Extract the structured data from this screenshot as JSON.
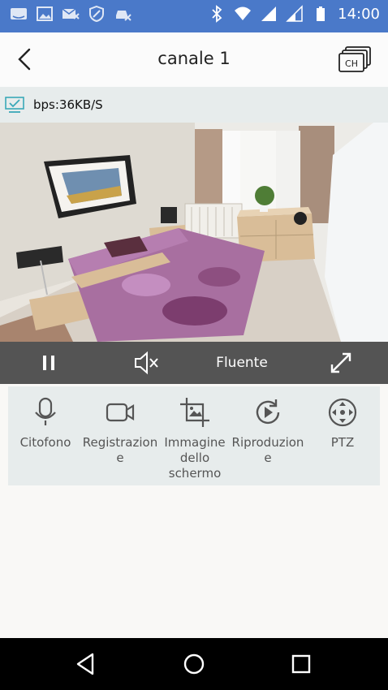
{
  "status_bar": {
    "left_icons": [
      "amazon-icon",
      "gallery-icon",
      "mail-x-icon",
      "shield-icon",
      "car-crossed-icon"
    ],
    "right_icons": [
      "bluetooth-icon",
      "wifi-icon",
      "signal-icon",
      "signal-2-icon",
      "battery-icon"
    ],
    "time": "14:00"
  },
  "header": {
    "title": "canale 1",
    "ch_label": "CH"
  },
  "info": {
    "bps": "bps:36KB/S"
  },
  "controls": {
    "quality": "Fluente"
  },
  "tools": [
    {
      "label": "Citofono",
      "icon": "microphone-icon"
    },
    {
      "label": "Registrazion\ne",
      "icon": "video-camera-icon"
    },
    {
      "label": "Immagine\ndello\nschermo",
      "icon": "screenshot-icon"
    },
    {
      "label": "Riproduzion\ne",
      "icon": "replay-icon"
    },
    {
      "label": "PTZ",
      "icon": "ptz-icon"
    }
  ],
  "colors": {
    "status_bar": "#4a79c9",
    "controls_bar": "#545454",
    "panel": "#e7ecec",
    "accent": "#3aa8b8"
  }
}
